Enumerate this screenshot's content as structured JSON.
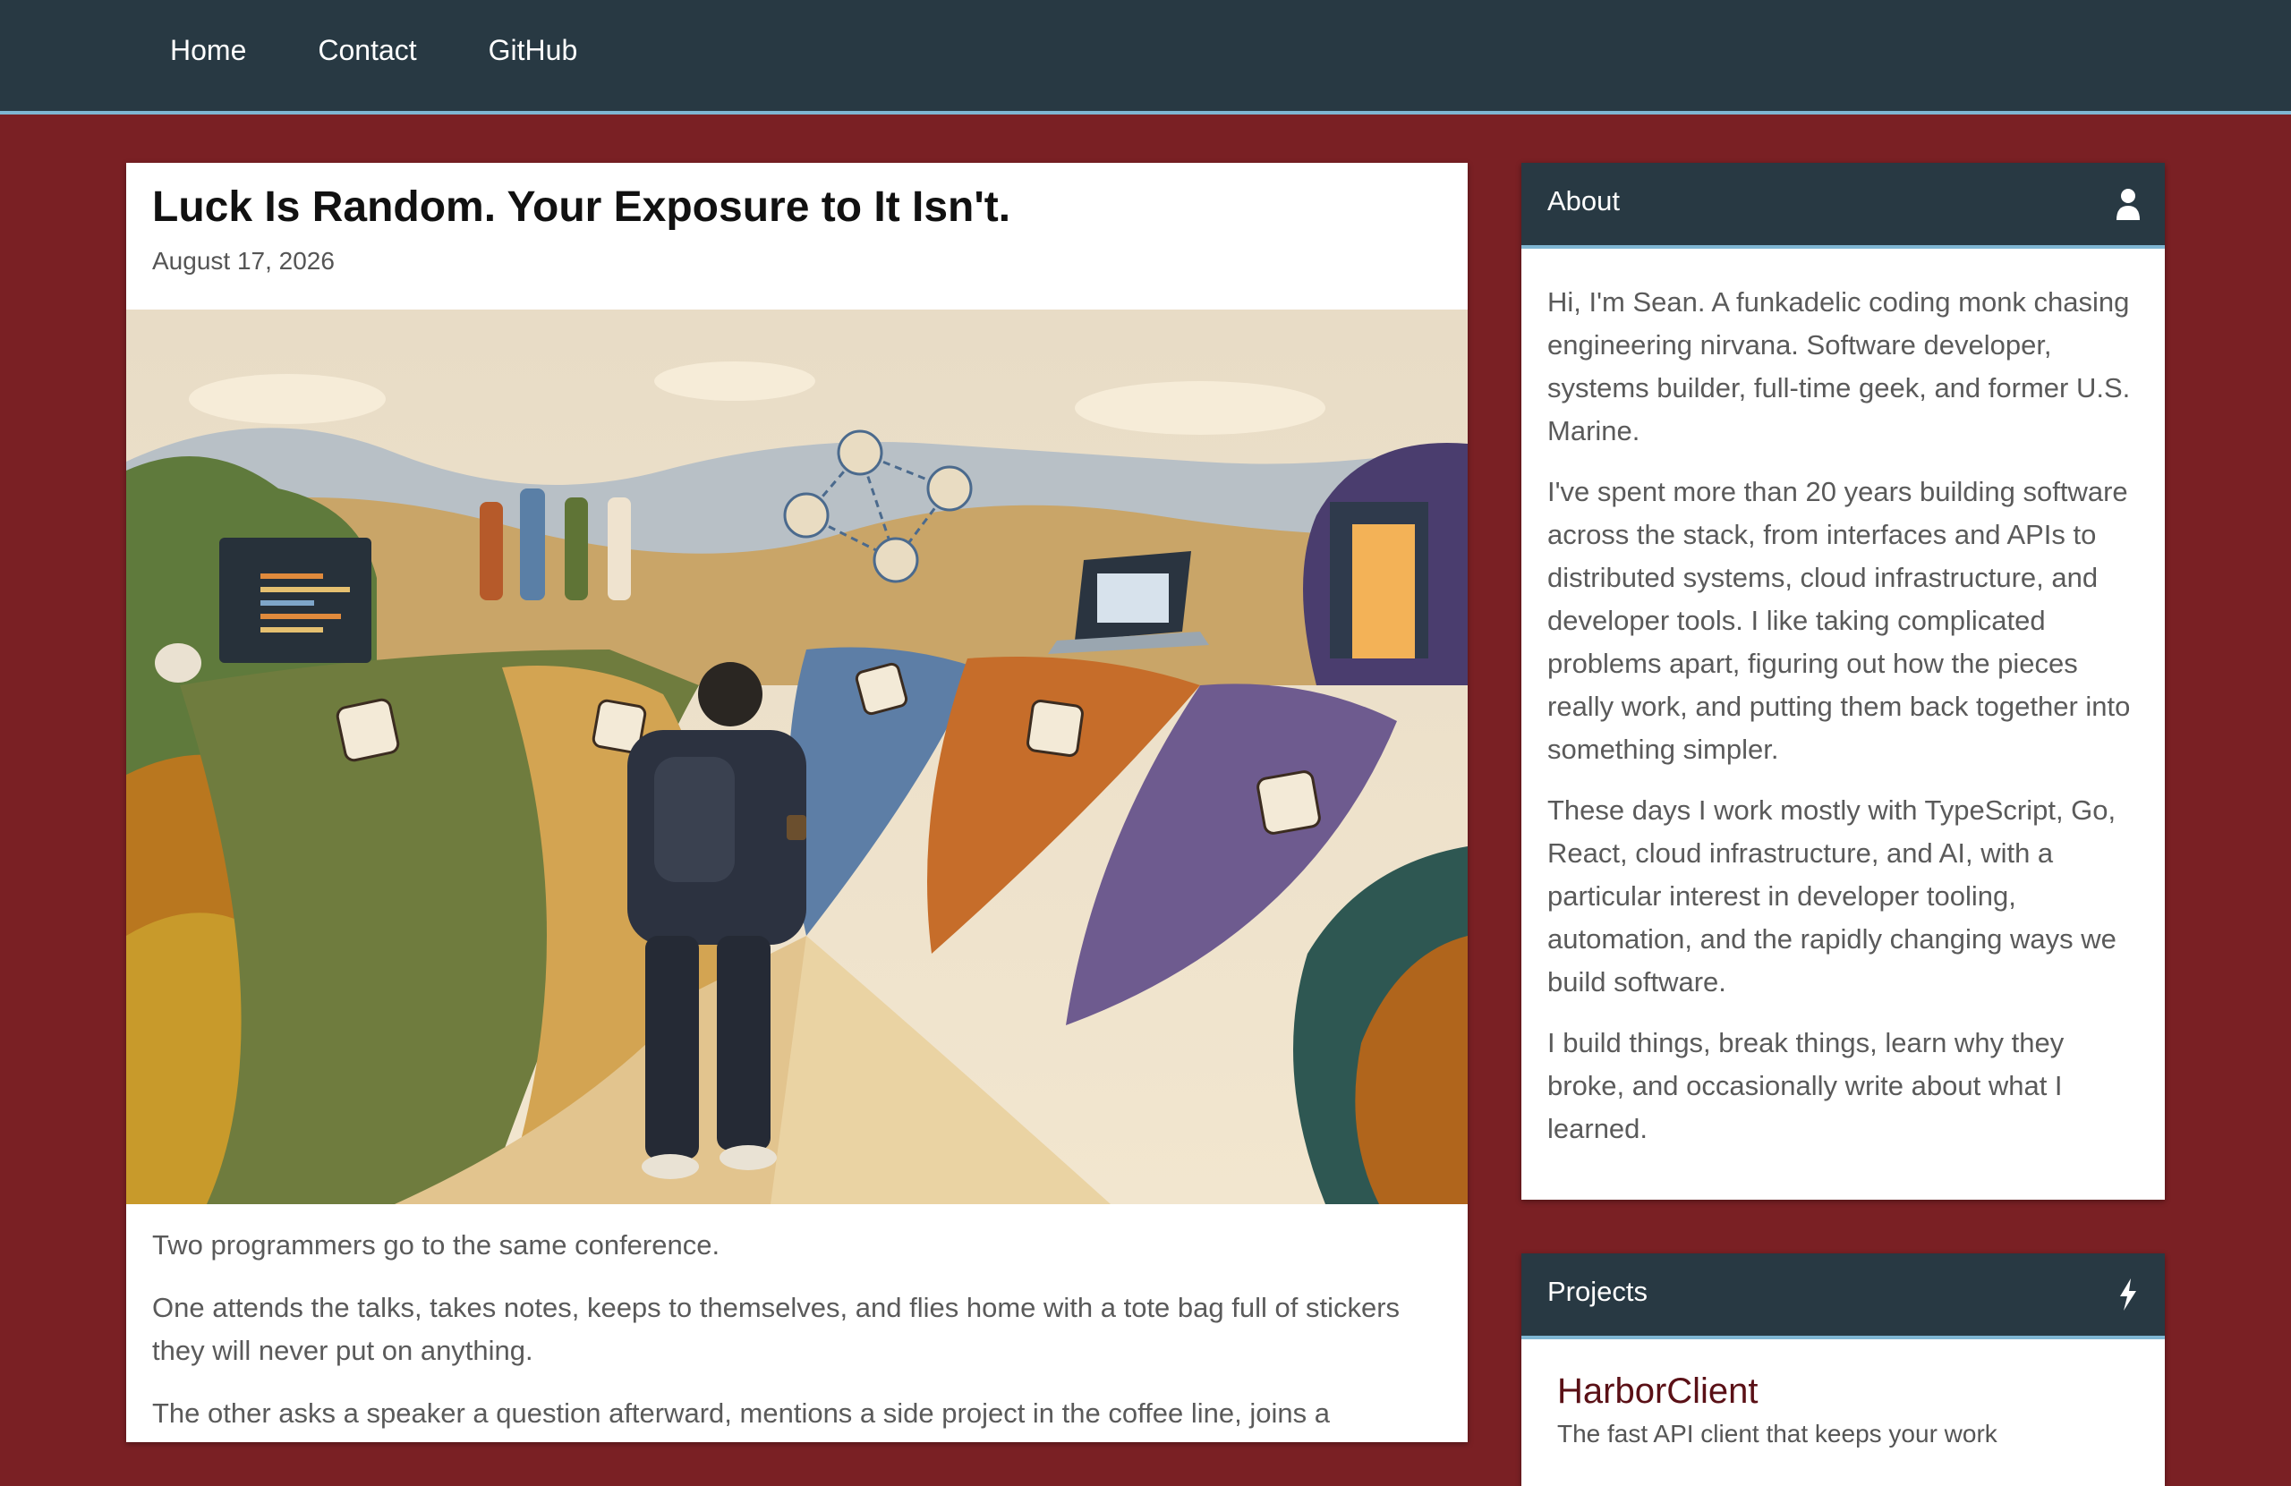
{
  "nav": {
    "items": [
      {
        "label": "Home"
      },
      {
        "label": "Contact"
      },
      {
        "label": "GitHub"
      }
    ]
  },
  "article": {
    "title": "Luck Is Random. Your Exposure to It Isn't.",
    "date": "August 17, 2026",
    "paragraphs": [
      "Two programmers go to the same conference.",
      "One attends the talks, takes notes, keeps to themselves, and flies home with a tote bag full of stickers they will never put on anything.",
      "The other asks a speaker a question afterward, mentions a side project in the coffee line, joins a"
    ]
  },
  "about": {
    "title": "About",
    "icon": "user-icon",
    "paragraphs": [
      "Hi, I'm Sean. A funkadelic coding monk chasing engineering nirvana. Software developer, systems builder, full-time geek, and former U.S. Marine.",
      "I've spent more than 20 years building software across the stack, from interfaces and APIs to distributed systems, cloud infrastructure, and developer tools. I like taking complicated problems apart, figuring out how the pieces really work, and putting them back together into something simpler.",
      "These days I work mostly with TypeScript, Go, React, cloud infrastructure, and AI, with a particular interest in developer tooling, automation, and the rapidly changing ways we build software.",
      "I build things, break things, learn why they broke, and occasionally write about what I learned."
    ]
  },
  "projects": {
    "title": "Projects",
    "icon": "bolt-icon",
    "items": [
      {
        "name": "HarborClient",
        "description": "The fast API client that keeps your work"
      }
    ]
  },
  "colors": {
    "page_bg": "#7a2024",
    "nav_bg": "#283943",
    "accent": "#7fb6d3"
  }
}
